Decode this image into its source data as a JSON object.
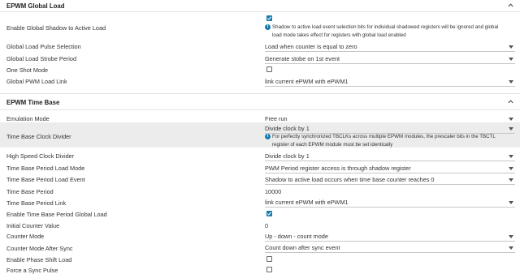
{
  "sections": {
    "global_load": {
      "title": "EPWM Global Load"
    },
    "time_base": {
      "title": "EPWM Time Base"
    }
  },
  "global_load": {
    "enable_shadow_label": "Enable Global Shadow to Active Load",
    "enable_shadow_info": "Shadow to active load event selection bits for individual shadowed registers will be ignored and global load mode takes effect for registers with global load enabled",
    "pulse_selection_label": "Global Load Pulse Selection",
    "pulse_selection_value": "Load when counter is equal to zero",
    "strobe_period_label": "Global Load Strobe Period",
    "strobe_period_value": "Generate stobe on 1st event",
    "one_shot_label": "One Shot Mode",
    "pwm_load_link_label": "Global PWM Load Link",
    "pwm_load_link_value": "link current ePWM with ePWM1"
  },
  "time_base": {
    "emulation_mode_label": "Emulation Mode",
    "emulation_mode_value": "Free run",
    "clock_divider_label": "Time Base Clock Divider",
    "clock_divider_value": "Divide clock by 1",
    "clock_divider_info": "For perfectly synchronized TBCLKs across multiple EPWM modules, the prescaler bits in the TBCTL register of each EPWM module must be set identically",
    "hs_clock_divider_label": "High Speed Clock Divider",
    "hs_clock_divider_value": "Divide clock by 1",
    "period_load_mode_label": "Time Base Period Load Mode",
    "period_load_mode_value": "PWM Period register access is through shadow register",
    "period_load_event_label": "Time Base Period Load Event",
    "period_load_event_value": "Shadow to active load occurs when time base counter reaches 0",
    "period_label": "Time Base Period",
    "period_value": "10000",
    "period_link_label": "Time Base Period Link",
    "period_link_value": "link current ePWM with ePWM1",
    "period_global_load_label": "Enable Time Base Period Global Load",
    "initial_counter_label": "Initial Counter Value",
    "initial_counter_value": "0",
    "counter_mode_label": "Counter Mode",
    "counter_mode_value": "Up - down - count mode",
    "counter_mode_sync_label": "Counter Mode After Sync",
    "counter_mode_sync_value": "Count down after sync event",
    "phase_shift_label": "Enable Phase Shift Load",
    "force_sync_label": "Force a Sync Pulse"
  },
  "checkbox_states": {
    "enable_shadow": true,
    "one_shot": false,
    "period_global_load": true,
    "phase_shift": false,
    "force_sync": false
  },
  "colors": {
    "accent": "#187bad",
    "highlight": "#ececec"
  }
}
